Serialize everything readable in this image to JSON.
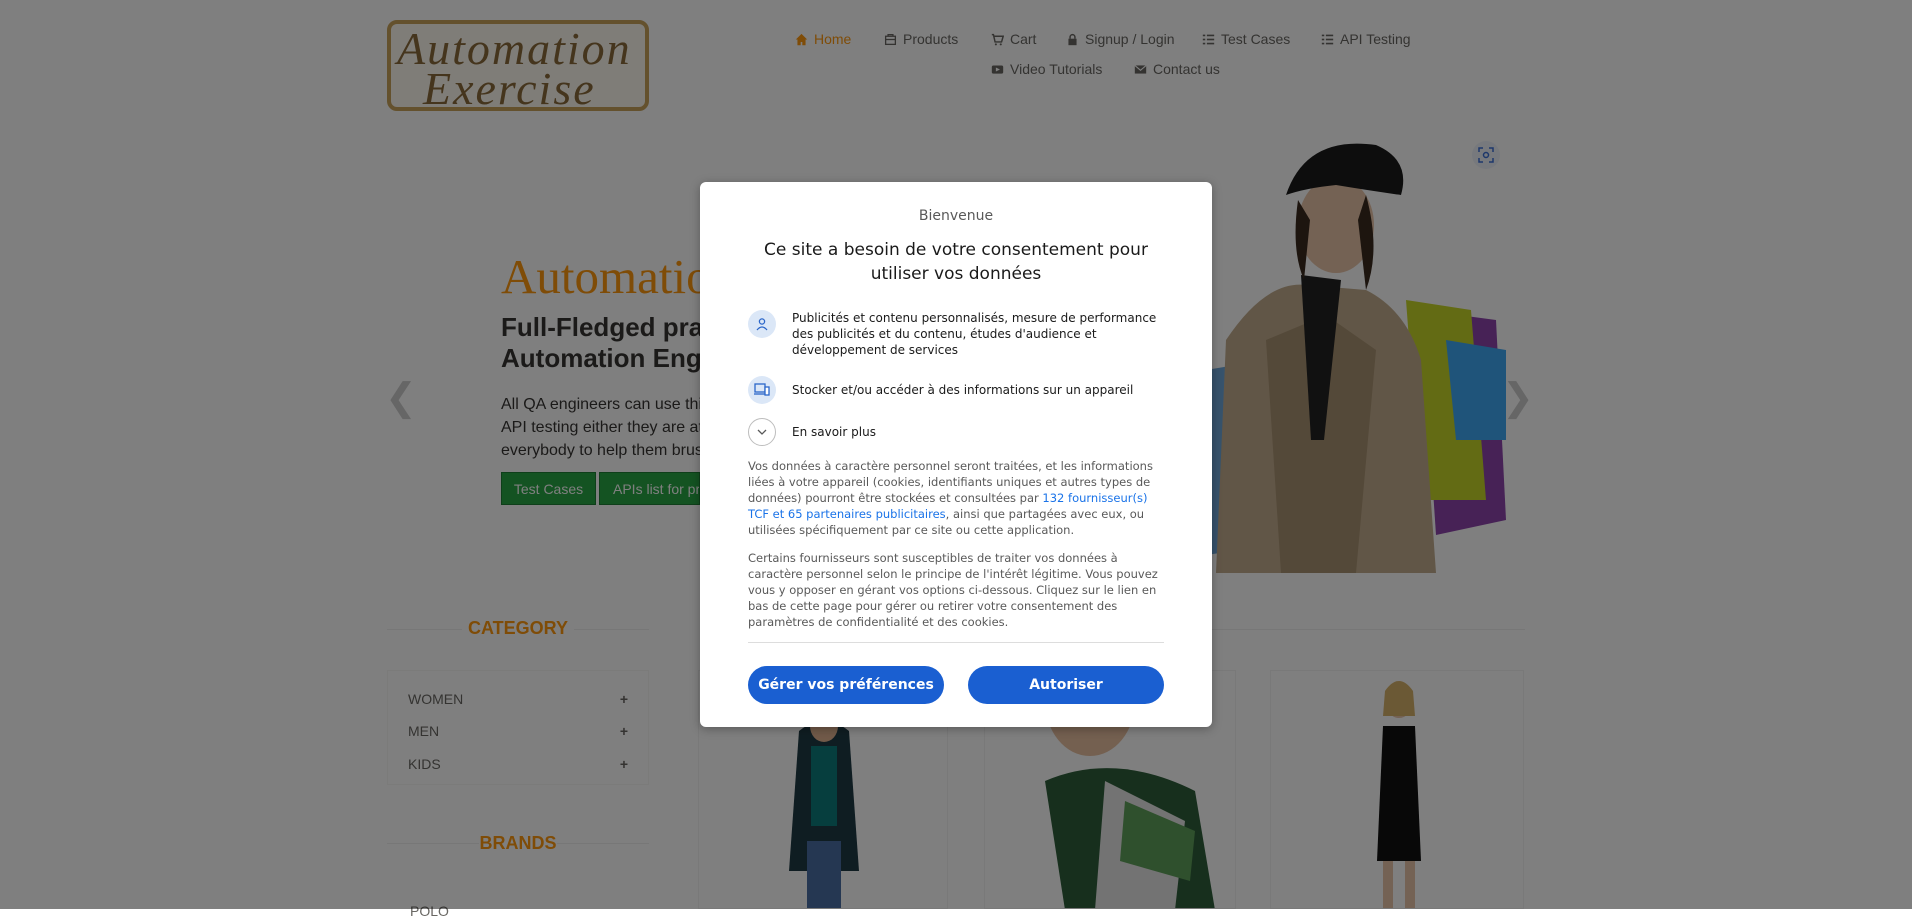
{
  "header": {
    "logo": {
      "line1": "Automation",
      "line2": "Exercise"
    },
    "nav": [
      {
        "label": "Home",
        "icon": "home-icon"
      },
      {
        "label": "Products",
        "icon": "products-icon"
      },
      {
        "label": "Cart",
        "icon": "cart-icon"
      },
      {
        "label": "Signup / Login",
        "icon": "lock-icon"
      },
      {
        "label": "Test Cases",
        "icon": "list-icon"
      },
      {
        "label": "API Testing",
        "icon": "list-icon"
      },
      {
        "label": "Video Tutorials",
        "icon": "youtube-icon"
      },
      {
        "label": "Contact us",
        "icon": "envelope-icon"
      }
    ]
  },
  "hero": {
    "title": "Automatio",
    "subtitle_line1": "Full-Fledged pra",
    "subtitle_line2": "Automation Eng",
    "para_line1": "All QA engineers can use thi",
    "para_line2": "API testing either they are at",
    "para_line3": "everybody to help them brus",
    "btn_test_cases": "Test Cases",
    "btn_apis": "APIs list for pr"
  },
  "sidebar": {
    "category_title": "CATEGORY",
    "categories": [
      "WOMEN",
      "MEN",
      "KIDS"
    ],
    "brands_title": "BRANDS",
    "first_brand": "POLO"
  },
  "consent": {
    "welcome": "Bienvenue",
    "title": "Ce site a besoin de votre consentement pour utiliser vos données",
    "purposes": [
      "Publicités et contenu personnalisés, mesure de performance des publicités et du contenu, études d'audience et développement de services",
      "Stocker et/ou accéder à des informations sur un appareil",
      "En savoir plus"
    ],
    "para1_before": "Vos données à caractère personnel seront traitées, et les informations liées à votre appareil (cookies, identifiants uniques et autres types de données) pourront être stockées et consultées par ",
    "para1_link": "132 fournisseur(s) TCF et 65 partenaires publicitaires",
    "para1_after": ", ainsi que partagées avec eux, ou utilisées spécifiquement par ce site ou cette application.",
    "para2": "Certains fournisseurs sont susceptibles de traiter vos données à caractère personnel selon le principe de l'intérêt légitime. Vous pouvez vous y opposer en gérant vos options ci-dessous. Cliquez sur le lien en bas de cette page pour gérer ou retirer votre consentement des paramètres de confidentialité et des cookies.",
    "btn_manage": "Gérer vos préférences",
    "btn_allow": "Autoriser"
  },
  "colors": {
    "accent": "#FE980F",
    "consent_blue": "#1a5fd1",
    "green": "#28a745"
  }
}
